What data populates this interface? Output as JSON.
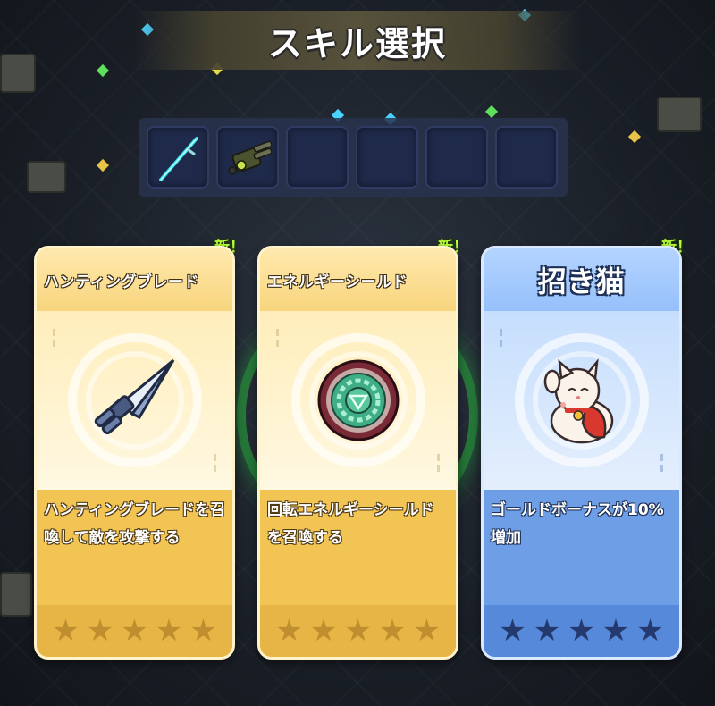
{
  "title": "スキル選択",
  "owned_slots": [
    {
      "icon": "energy-sword-icon"
    },
    {
      "icon": "gatling-gun-icon"
    },
    {
      "icon": ""
    },
    {
      "icon": ""
    },
    {
      "icon": ""
    },
    {
      "icon": ""
    }
  ],
  "cards": [
    {
      "badge": "新！",
      "name": "ハンティングブレード",
      "icon": "hunting-blade-icon",
      "description": "ハンティングブレードを召喚して敵を攻撃する",
      "stars": 0,
      "max_stars": 5,
      "theme": "gold"
    },
    {
      "badge": "新！",
      "name": "エネルギーシールド",
      "icon": "energy-shield-icon",
      "description": "回転エネルギーシールドを召喚する",
      "stars": 0,
      "max_stars": 5,
      "theme": "gold"
    },
    {
      "badge": "新！",
      "name": "招き猫",
      "icon": "lucky-cat-icon",
      "description": "ゴールドボーナスが10%増加",
      "stars": 0,
      "max_stars": 5,
      "theme": "blue"
    }
  ]
}
